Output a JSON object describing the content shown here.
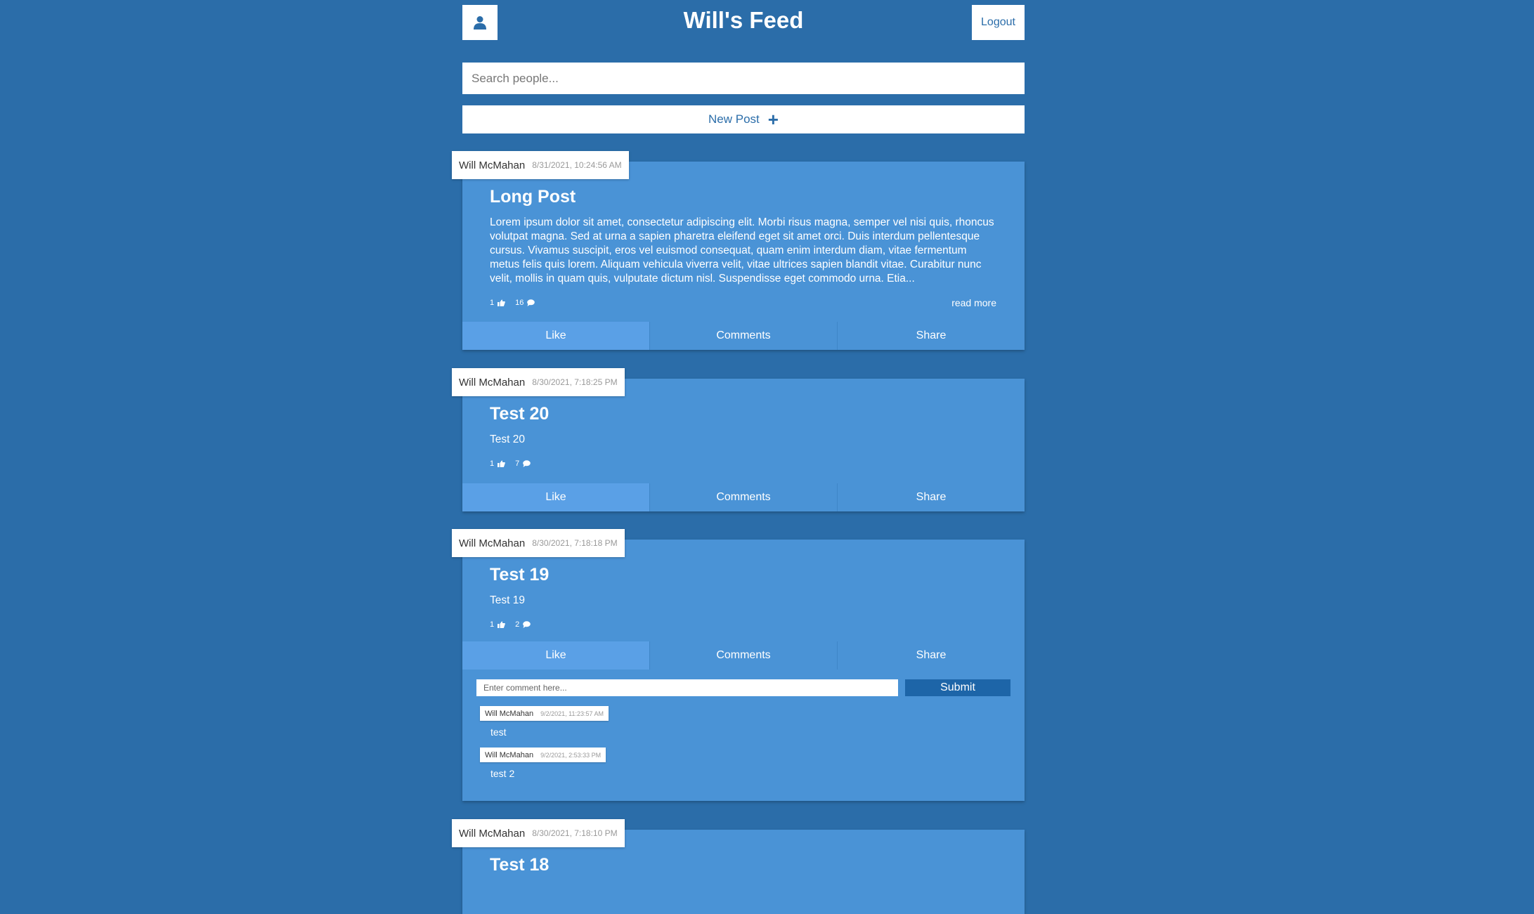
{
  "header": {
    "title": "Will's Feed",
    "logout_label": "Logout",
    "profile_icon": "user-icon"
  },
  "search": {
    "placeholder": "Search people..."
  },
  "new_post": {
    "label": "New Post",
    "icon": "plus-icon"
  },
  "actions": {
    "like": "Like",
    "comments": "Comments",
    "share": "Share"
  },
  "posts": [
    {
      "author": "Will McMahan",
      "timestamp": "8/31/2021, 10:24:56 AM",
      "title": "Long Post",
      "body": "Lorem ipsum dolor sit amet, consectetur adipiscing elit. Morbi risus magna, semper vel nisi quis, rhoncus volutpat magna. Sed at urna a sapien pharetra eleifend eget sit amet orci. Duis interdum pellentesque cursus. Vivamus suscipit, eros vel euismod consequat, quam enim interdum diam, vitae fermentum metus felis quis lorem. Aliquam vehicula viverra velit, vitae ultrices sapien blandit vitae. Curabitur nunc velit, mollis in quam quis, vulputate dictum nisl. Suspendisse eget commodo urna. Etia...",
      "likes": "1",
      "comments_count": "16",
      "read_more": "read more"
    },
    {
      "author": "Will McMahan",
      "timestamp": "8/30/2021, 7:18:25 PM",
      "title": "Test 20",
      "body": "Test 20",
      "likes": "1",
      "comments_count": "7"
    },
    {
      "author": "Will McMahan",
      "timestamp": "8/30/2021, 7:18:18 PM",
      "title": "Test 19",
      "body": "Test 19",
      "likes": "1",
      "comments_count": "2",
      "comment_input_placeholder": "Enter comment here...",
      "submit_label": "Submit",
      "comments": [
        {
          "author": "Will McMahan",
          "timestamp": "9/2/2021, 11:23:57 AM",
          "text": "test"
        },
        {
          "author": "Will McMahan",
          "timestamp": "9/2/2021, 2:53:33 PM",
          "text": "test 2"
        }
      ]
    },
    {
      "author": "Will McMahan",
      "timestamp": "8/30/2021, 7:18:10 PM",
      "title": "Test 18"
    }
  ]
}
